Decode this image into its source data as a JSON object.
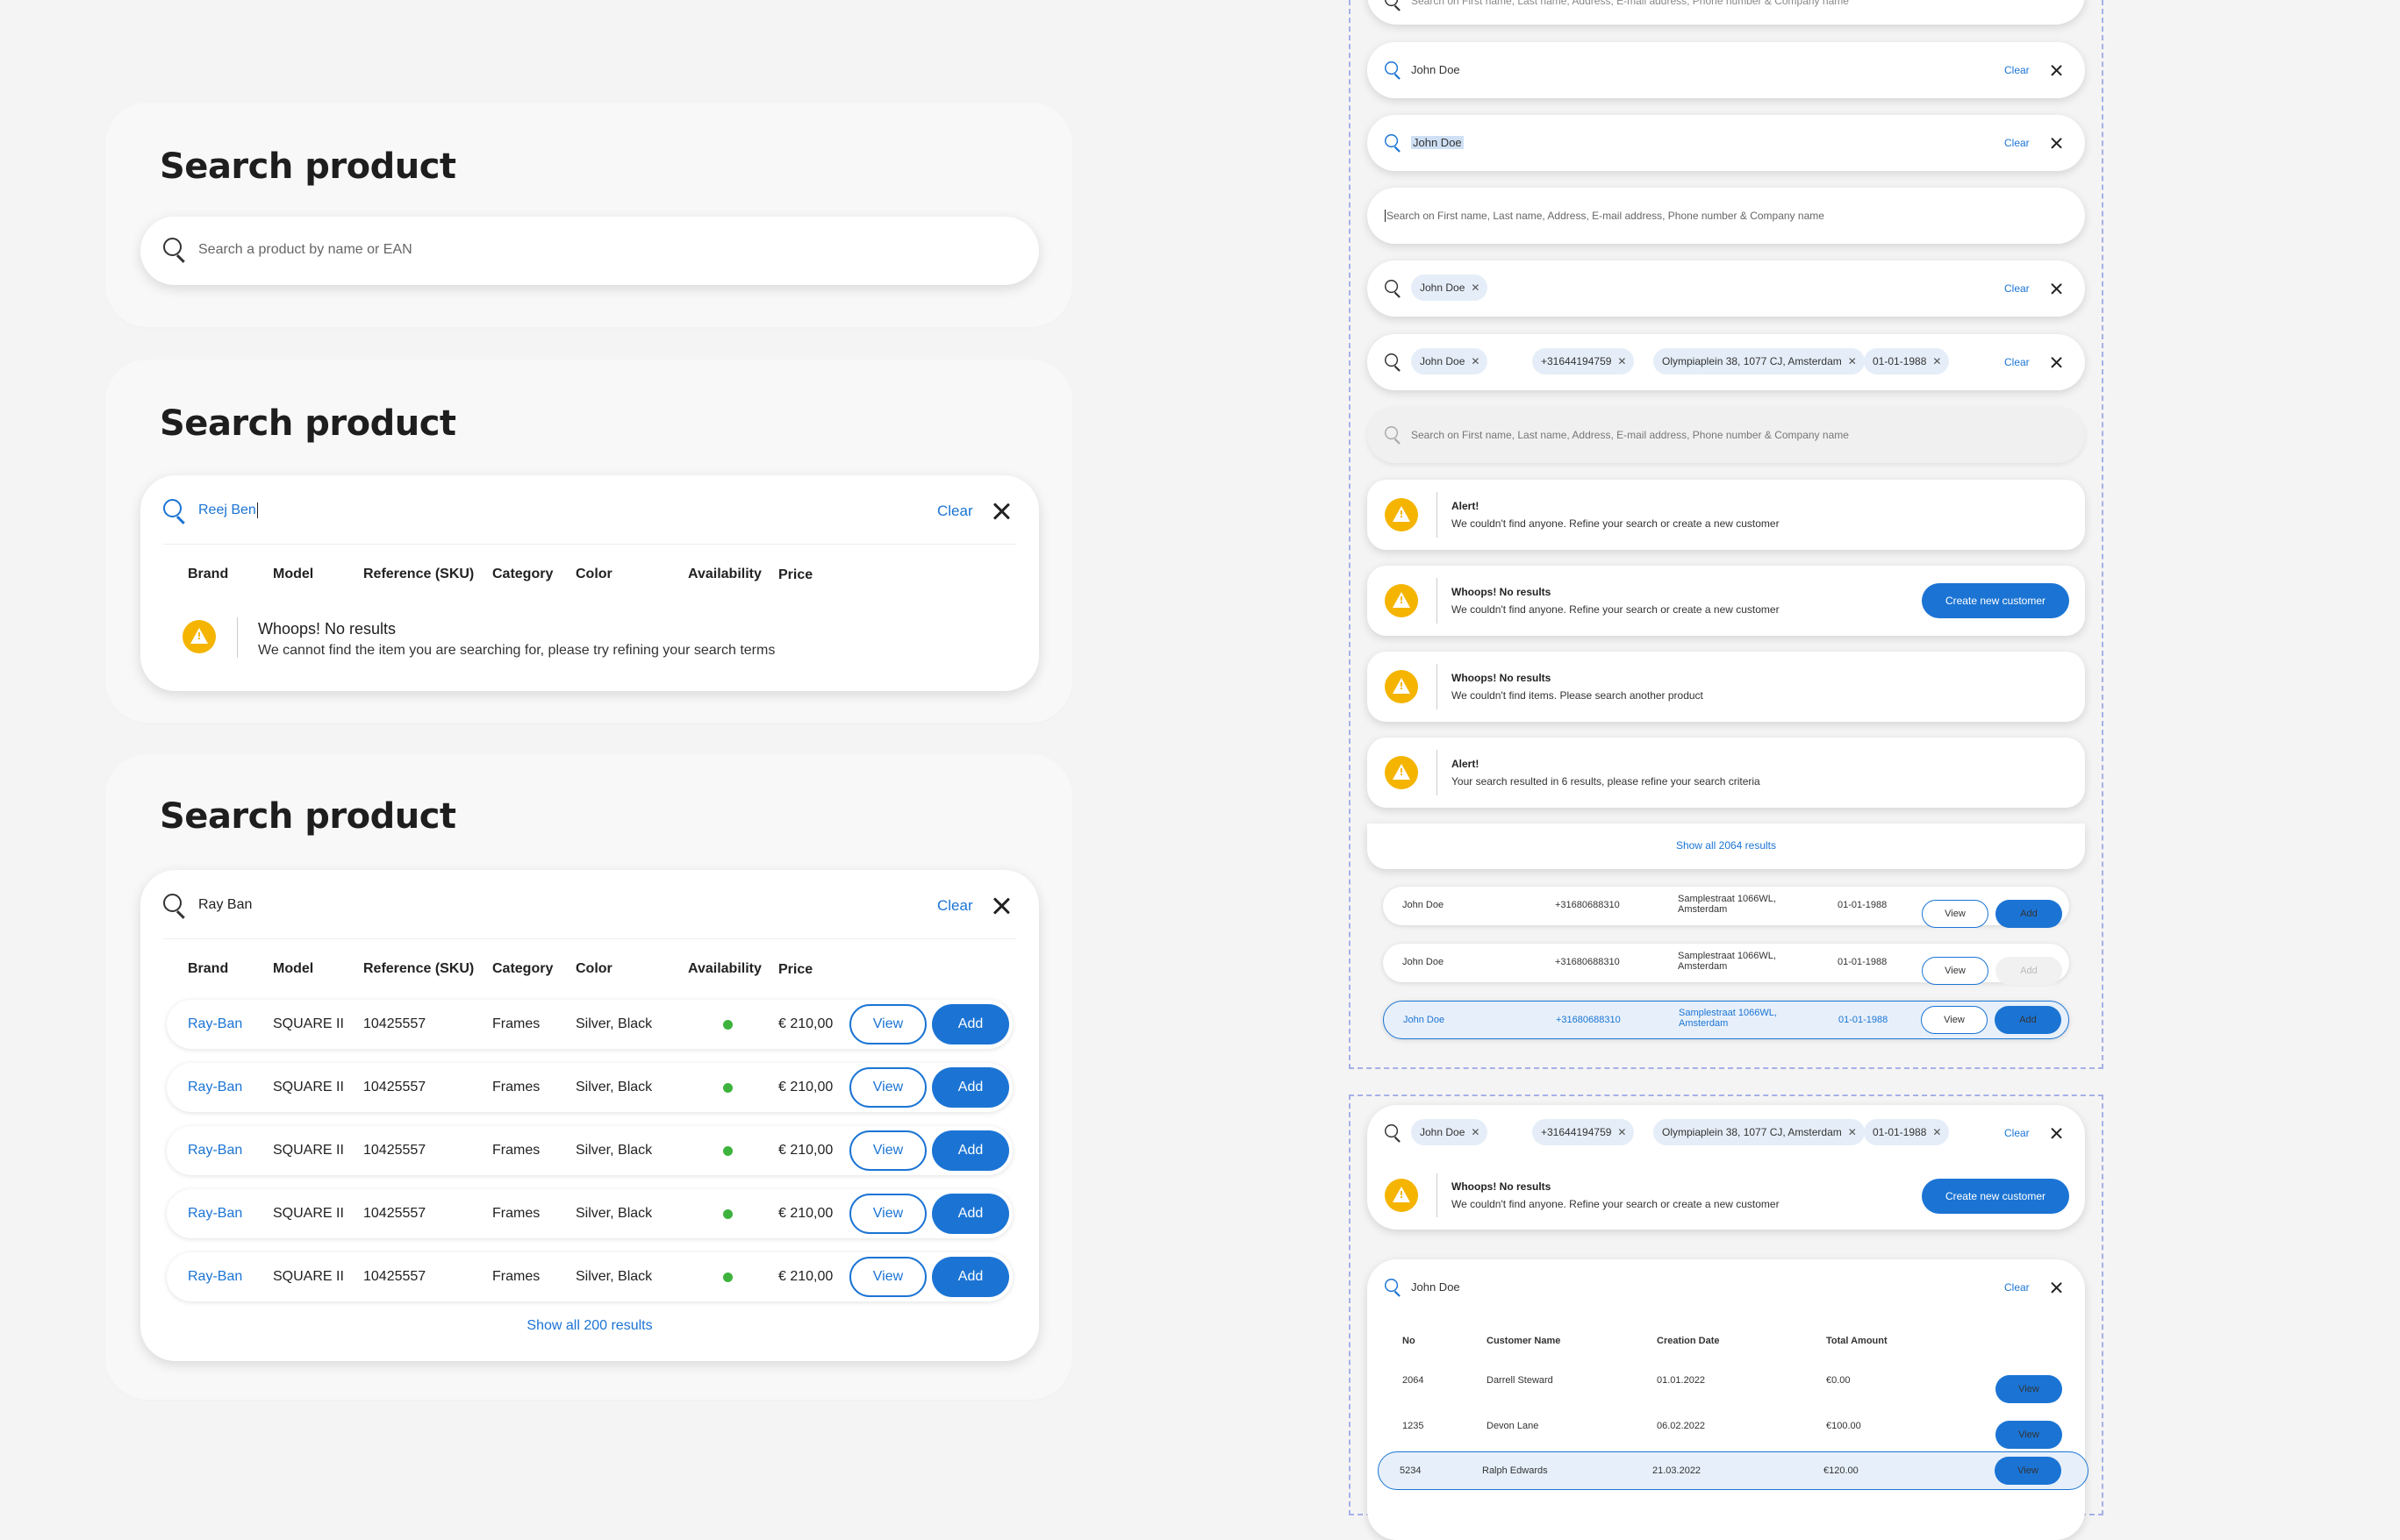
{
  "colors": {
    "accent": "#1b74d4",
    "warning": "#f4b400",
    "available": "#3db33d",
    "selected_bg": "#e7f0fa"
  },
  "left": {
    "card1": {
      "title": "Search product",
      "placeholder": "Search a product by name or EAN"
    },
    "card2": {
      "title": "Search product",
      "query": "Reej Ben",
      "clear": "Clear",
      "headers": [
        "Brand",
        "Model",
        "Reference (SKU)",
        "Category",
        "Color",
        "Availability",
        "Price"
      ],
      "empty_title": "Whoops! No results",
      "empty_text": "We cannot find the item you are searching for, please try refining your search terms"
    },
    "card3": {
      "title": "Search product",
      "query": "Ray Ban",
      "clear": "Clear",
      "headers": [
        "Brand",
        "Model",
        "Reference (SKU)",
        "Category",
        "Color",
        "Availability",
        "Price"
      ],
      "rows": [
        {
          "brand": "Ray-Ban",
          "model": "SQUARE II",
          "sku": "10425557",
          "category": "Frames",
          "color": "Silver, Black",
          "price": "€ 210,00",
          "view": "View",
          "add": "Add"
        },
        {
          "brand": "Ray-Ban",
          "model": "SQUARE II",
          "sku": "10425557",
          "category": "Frames",
          "color": "Silver, Black",
          "price": "€ 210,00",
          "view": "View",
          "add": "Add"
        },
        {
          "brand": "Ray-Ban",
          "model": "SQUARE II",
          "sku": "10425557",
          "category": "Frames",
          "color": "Silver, Black",
          "price": "€ 210,00",
          "view": "View",
          "add": "Add"
        },
        {
          "brand": "Ray-Ban",
          "model": "SQUARE II",
          "sku": "10425557",
          "category": "Frames",
          "color": "Silver, Black",
          "price": "€ 210,00",
          "view": "View",
          "add": "Add"
        },
        {
          "brand": "Ray-Ban",
          "model": "SQUARE II",
          "sku": "10425557",
          "category": "Frames",
          "color": "Silver, Black",
          "price": "€ 210,00",
          "view": "View",
          "add": "Add"
        }
      ],
      "show_all": "Show all 200 results"
    }
  },
  "right": {
    "clear": "Clear",
    "name": "John Doe",
    "placeholder": "Search on First name, Last name, Address, E-mail address, Phone number & Company name",
    "top_partial": "Search on First name, Last name, Address, E-mail address, Phone number & Company name",
    "chips": [
      "John Doe",
      "+31644194759",
      "Olympiaplein 38, 1077 CJ, Amsterdam",
      "01-01-1988"
    ],
    "alerts": [
      {
        "title": "Alert!",
        "text": "We couldn't find anyone. Refine your search or create a new customer"
      },
      {
        "title": "Whoops! No results",
        "text": "We couldn't find anyone. Refine your search or create a new customer",
        "button": "Create new customer"
      },
      {
        "title": "Whoops! No results",
        "text": "We couldn't find items. Please search another product"
      },
      {
        "title": "Alert!",
        "text": "Your search resulted in 6 results, please refine your search criteria"
      }
    ],
    "show_all": "Show all 2064 results",
    "customer_rows": [
      {
        "name": "John Doe",
        "phone": "+31680688310",
        "addr1": "Samplestraat 1066WL,",
        "addr2": "Amsterdam",
        "dob": "01-01-1988",
        "view": "View",
        "add": "Add"
      },
      {
        "name": "John Doe",
        "phone": "+31680688310",
        "addr1": "Samplestraat 1066WL,",
        "addr2": "Amsterdam",
        "dob": "01-01-1988",
        "view": "View",
        "add": "Add"
      },
      {
        "name": "John Doe",
        "phone": "+31680688310",
        "addr1": "Samplestraat 1066WL,",
        "addr2": "Amsterdam",
        "dob": "01-01-1988",
        "view": "View",
        "add": "Add"
      }
    ],
    "bottom_alert": {
      "title": "Whoops! No results",
      "text": "We couldn't find anyone. Refine your search or create a new customer",
      "button": "Create new customer"
    },
    "orders": {
      "query": "John Doe",
      "headers": [
        "No",
        "Customer Name",
        "Creation Date",
        "Total Amount"
      ],
      "rows": [
        {
          "no": "2064",
          "name": "Darrell Steward",
          "date": "01.01.2022",
          "amount": "€0.00",
          "view": "View"
        },
        {
          "no": "1235",
          "name": "Devon Lane",
          "date": "06.02.2022",
          "amount": "€100.00",
          "view": "View"
        },
        {
          "no": "5234",
          "name": "Ralph Edwards",
          "date": "21.03.2022",
          "amount": "€120.00",
          "view": "View"
        }
      ]
    }
  }
}
